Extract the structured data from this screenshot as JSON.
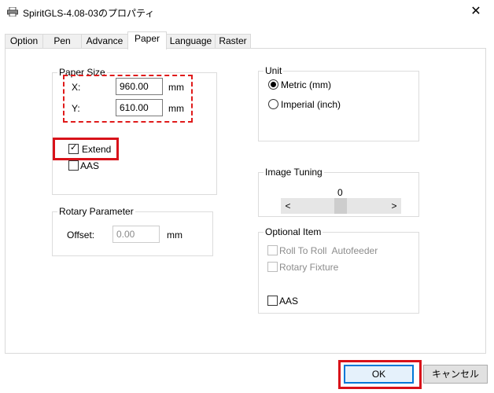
{
  "window": {
    "title": "SpiritGLS-4.08-03のプロパティ",
    "icon": "printer-icon",
    "close_glyph": "✕"
  },
  "tabs": [
    {
      "label": "Option",
      "active": false
    },
    {
      "label": "Pen",
      "active": false
    },
    {
      "label": "Advance",
      "active": false
    },
    {
      "label": "Paper",
      "active": true
    },
    {
      "label": "Language",
      "active": false
    },
    {
      "label": "Raster",
      "active": false
    }
  ],
  "paper_size": {
    "legend": "Paper Size",
    "x_label": "X:",
    "x_value": "960.00",
    "x_unit": "mm",
    "y_label": "Y:",
    "y_value": "610.00",
    "y_unit": "mm",
    "extend_label": "Extend",
    "extend_checked": true,
    "aas_label": "AAS",
    "aas_checked": false
  },
  "unit": {
    "legend": "Unit",
    "metric_label": "Metric (mm)",
    "metric_selected": true,
    "imperial_label": "Imperial (inch)",
    "imperial_selected": false
  },
  "image_tuning": {
    "legend": "Image Tuning",
    "value": "0",
    "left_arrow": "<",
    "right_arrow": ">"
  },
  "rotary": {
    "legend": "Rotary Parameter",
    "offset_label": "Offset:",
    "offset_value": "0.00",
    "offset_unit": "mm"
  },
  "optional_item": {
    "legend": "Optional Item",
    "roll_label": "Roll To Roll  Autofeeder",
    "rotary_fixture_label": "Rotary Fixture",
    "aas_label": "AAS"
  },
  "buttons": {
    "ok": "OK",
    "cancel": "キャンセル"
  },
  "colors": {
    "highlight_red": "#d8121a",
    "default_button_border": "#0078d7"
  }
}
